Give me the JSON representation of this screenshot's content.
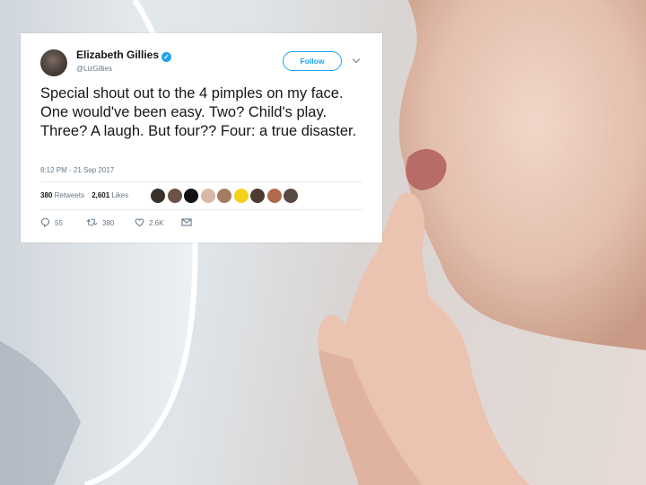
{
  "tweet": {
    "author_name": "Elizabeth Gillies",
    "verified": true,
    "handle": "@LizGillies",
    "follow_label": "Follow",
    "text": "Special shout out to the 4 pimples on my face. One would've been easy. Two? Child's play. Three? A laugh. But four?? Four: a true disaster.",
    "timestamp": "8:12 PM - 21 Sep 2017",
    "stats": {
      "retweets_count": "380",
      "retweets_label": "Retweets",
      "likes_count": "2,601",
      "likes_label": "Likes"
    },
    "liker_avatar_colors": [
      "#3a2f2c",
      "#6b5246",
      "#111111",
      "#d9b8a8",
      "#a47c63",
      "#f2d21a",
      "#4d3a33",
      "#b26a4e",
      "#5a4a44"
    ],
    "actions": {
      "replies": "55",
      "retweets": "380",
      "likes": "2.6K"
    }
  },
  "colors": {
    "accent": "#1da1f2",
    "text": "#14171a",
    "muted": "#657786"
  }
}
